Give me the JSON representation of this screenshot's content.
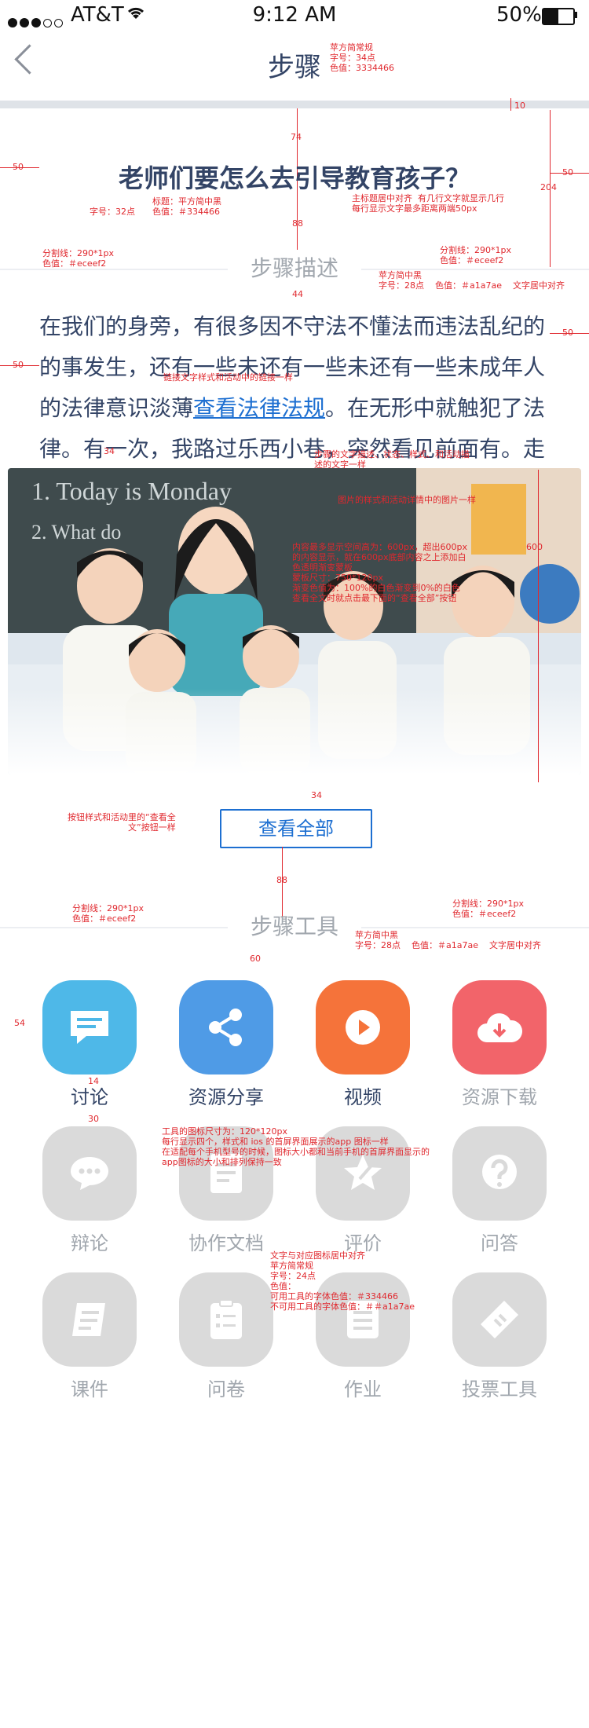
{
  "status_bar": {
    "carrier": "AT&T",
    "time": "9:12 AM",
    "battery": "50%"
  },
  "nav": {
    "title": "步骤"
  },
  "step": {
    "title": "老师们要怎么去引导教育孩子？",
    "section_desc": "步骤描述",
    "desc_before": "在我们的身旁，有很多因不守法不懂法而违法乱纪的的事发生，还有一些未还有一些未还有一些未成年人的法律意识淡薄",
    "desc_link": "查看法律法规",
    "desc_after": "。在无形中就触犯了法律。有一次，我路过乐西小巷，突然看见前面有。走一个初中生模样...",
    "view_all": "查看全部",
    "section_tools": "步骤工具"
  },
  "tools": [
    {
      "label": "讨论",
      "icon": "chat-bubble-icon",
      "color": "#4eb8e8",
      "enabled": true
    },
    {
      "label": "资源分享",
      "icon": "share-icon",
      "color": "#4f9be6",
      "enabled": true
    },
    {
      "label": "视频",
      "icon": "video-play-icon",
      "color": "#f5733a",
      "enabled": true
    },
    {
      "label": "资源下载",
      "icon": "cloud-download-icon",
      "color": "#f2646a",
      "enabled": false
    },
    {
      "label": "辩论",
      "icon": "debate-icon",
      "enabled": false
    },
    {
      "label": "协作文档",
      "icon": "document-icon",
      "enabled": false
    },
    {
      "label": "评价",
      "icon": "rating-icon",
      "enabled": false
    },
    {
      "label": "问答",
      "icon": "question-icon",
      "enabled": false
    },
    {
      "label": "课件",
      "icon": "courseware-icon",
      "enabled": false
    },
    {
      "label": "问卷",
      "icon": "survey-icon",
      "enabled": false
    },
    {
      "label": "作业",
      "icon": "homework-icon",
      "enabled": false
    },
    {
      "label": "投票工具",
      "icon": "vote-icon",
      "enabled": false
    }
  ],
  "colors": {
    "text": "#334466",
    "muted": "#a1a7ae",
    "divider": "#eceef2",
    "link": "#1d6fd1",
    "annotation": "#e0282e"
  },
  "annotations": {
    "nav_title": "苹方简常规\n字号：34点\n色值：3334466",
    "gap_10": "10",
    "gap_74": "74",
    "margin_50_a": "50",
    "margin_50_b": "50",
    "title_spec": "标题：平方简中黑\n色值：＃334466",
    "title_size": "字号：32点",
    "title_align": "主标题居中对齐  有几行文字就显示几行\n每行显示文字最多距离两端50px",
    "gap_204": "204",
    "gap_88a": "88",
    "divider_l": "分割线：290*1px\n色值：＃eceef2",
    "divider_r": "分割线：290*1px\n色值：＃eceef2",
    "section_spec": "苹方简中黑\n字号：28点    色值：＃a1a7ae    文字居中对齐",
    "gap_44": "44",
    "margin_50_c": "50",
    "margin_50_d": "50",
    "link_spec": "链接文字样式和活动中的链接一样",
    "gap_34a": "34",
    "desc_spec": "步骤的文字描述、状态、样式、和活动描\n述的文字一样",
    "image_spec": "图片的样式和活动详情中的图片一样",
    "height_600": "600",
    "image_detail": "内容最多显示空间高为：600px，超出600px\n的内容显示，就在600px底部内容之上添加白\n色透明渐变蒙板\n蒙板尺寸：750*120px\n渐变色值为：100%的白色渐变到0%的白色\n查看全文时就点击最下面的“查看全部”按钮",
    "gap_34b": "34",
    "btn_spec": "按钮样式和活动里的“查看全\n文”按钮一样",
    "gap_88b": "88",
    "divider_l2": "分割线：290*1px\n色值：＃eceef2",
    "divider_r2": "分割线：290*1px\n色值：＃eceef2",
    "section_spec2": "苹方简中黑\n字号：28点    色值：＃a1a7ae    文字居中对齐",
    "gap_60": "60",
    "gap_54": "54",
    "gap_14": "14",
    "gap_30": "30",
    "icon_spec": "工具的图标尺寸为：120*120px\n每行显示四个，样式和 ios 的首屏界面展示的app 图标一样\n在适配每个手机型号的时候，图标大小都和当前手机的首屏界面显示的\napp图标的大小和排列保持一致",
    "label_spec": "文字与对应图标居中对齐\n苹方简常规\n字号：24点\n色值：\n可用工具的字体色值：＃334466\n不可用工具的字体色值：＃＃a1a7ae"
  }
}
